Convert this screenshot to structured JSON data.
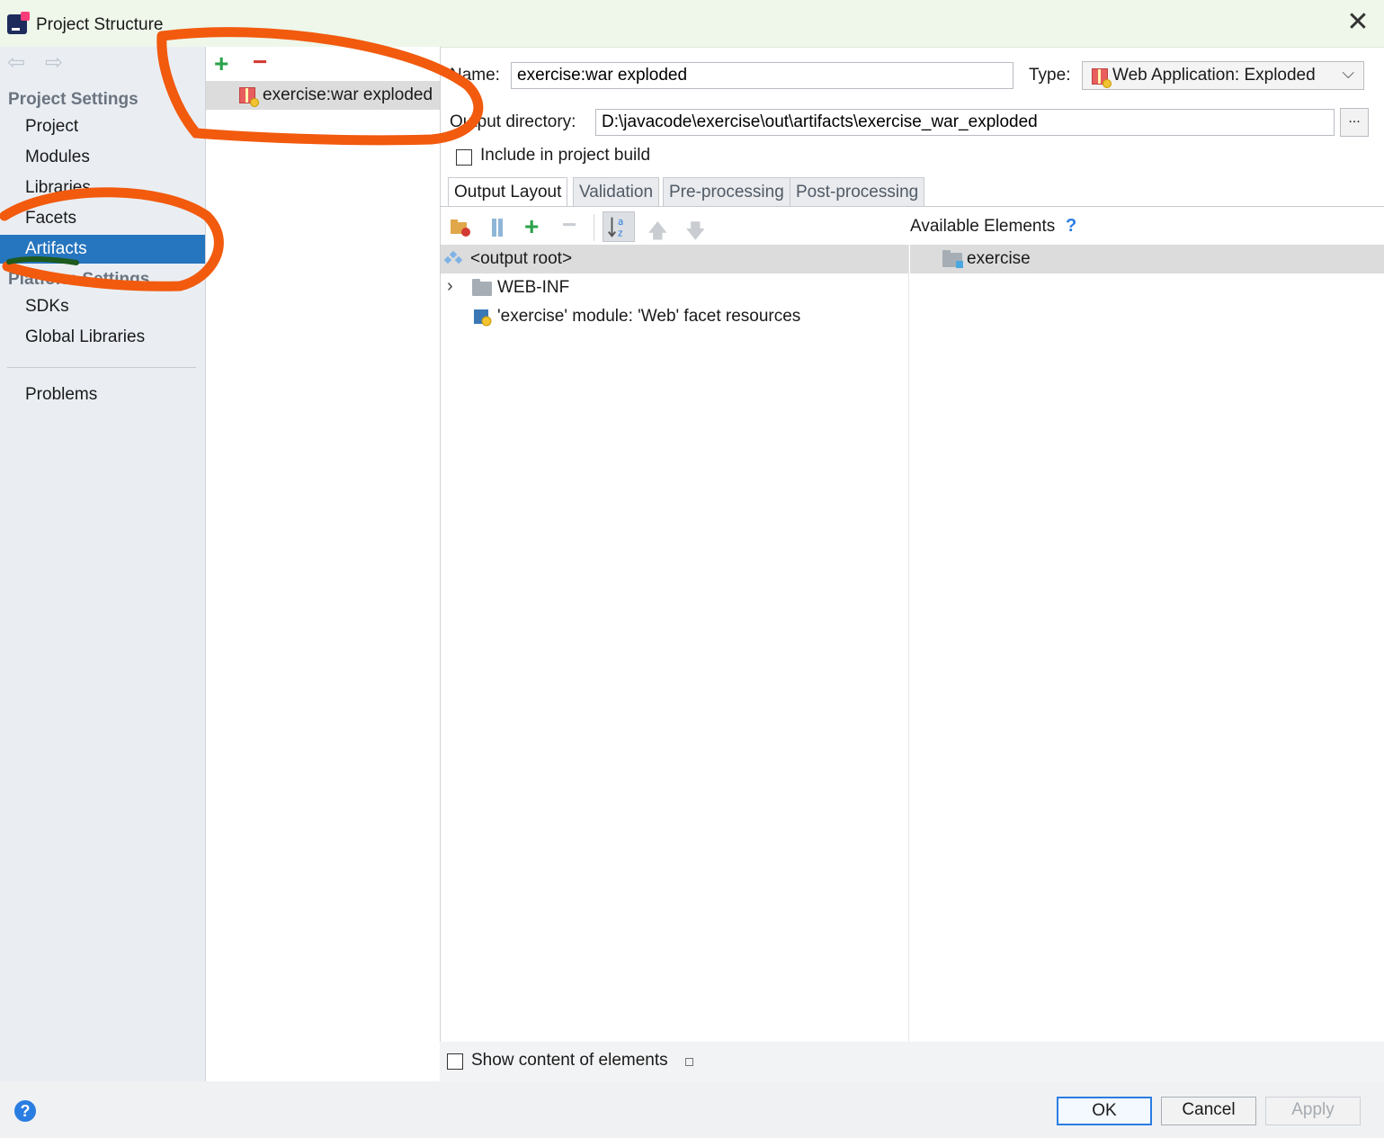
{
  "window": {
    "title": "Project Structure",
    "close_symbol": "✕"
  },
  "sidebar": {
    "project_settings_heading": "Project Settings",
    "project_settings_items": [
      "Project",
      "Modules",
      "Libraries",
      "Facets",
      "Artifacts"
    ],
    "selected_item": "Artifacts",
    "platform_settings_heading": "Platform Settings",
    "platform_settings_items": [
      "SDKs",
      "Global Libraries"
    ],
    "problems_label": "Problems"
  },
  "artifact_list": {
    "items": [
      {
        "label": "exercise:war exploded",
        "selected": true
      }
    ]
  },
  "details": {
    "name_label": "Name:",
    "name_value": "exercise:war exploded",
    "type_label": "Type:",
    "type_value": "Web Application: Exploded",
    "output_dir_label": "Output directory:",
    "output_dir_value": "D:\\javacode\\exercise\\out\\artifacts\\exercise_war_exploded",
    "browse_label": "...",
    "include_build_label": "Include in project build",
    "include_build_checked": false
  },
  "tabs": [
    {
      "label": "Output Layout",
      "active": true
    },
    {
      "label": "Validation",
      "active": false
    },
    {
      "label": "Pre-processing",
      "active": false
    },
    {
      "label": "Post-processing",
      "active": false
    }
  ],
  "output_layout": {
    "tree": [
      {
        "label": "<output root>",
        "icon": "output-root-icon",
        "selected": true
      },
      {
        "label": "WEB-INF",
        "icon": "folder-icon",
        "expandable": true
      },
      {
        "label": "'exercise' module: 'Web' facet resources",
        "icon": "web-facet-icon"
      }
    ],
    "available_elements_label": "Available Elements",
    "available_elements_help": "?",
    "available_elements": [
      {
        "label": "exercise",
        "icon": "module-folder-icon"
      }
    ],
    "show_content_label": "Show content of elements",
    "show_content_checked": false
  },
  "footer": {
    "help": "?",
    "ok_label": "OK",
    "cancel_label": "Cancel",
    "apply_label": "Apply",
    "apply_enabled": false
  },
  "colors": {
    "selection_blue": "#2675bf",
    "titlebar_bg": "#eef7ea",
    "annotation_orange": "#f25a0e",
    "add_green": "#2aa24a",
    "remove_red": "#d33a32"
  }
}
